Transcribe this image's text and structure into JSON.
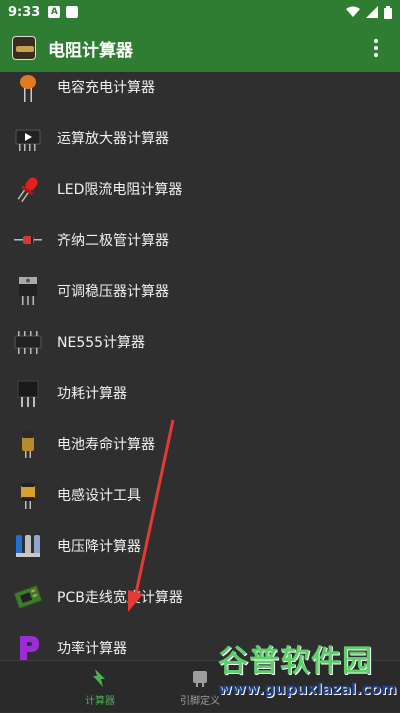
{
  "status_bar": {
    "time": "9:33"
  },
  "app_bar": {
    "title": "电阻计算器"
  },
  "list": {
    "items": [
      {
        "label": "电容充电计算器",
        "icon": "capacitor-icon"
      },
      {
        "label": "运算放大器计算器",
        "icon": "opamp-icon"
      },
      {
        "label": "LED限流电阻计算器",
        "icon": "led-icon"
      },
      {
        "label": "齐纳二极管计算器",
        "icon": "zener-diode-icon"
      },
      {
        "label": "可调稳压器计算器",
        "icon": "voltage-regulator-icon"
      },
      {
        "label": "NE555计算器",
        "icon": "ne555-chip-icon"
      },
      {
        "label": "功耗计算器",
        "icon": "power-transistor-icon"
      },
      {
        "label": "电池寿命计算器",
        "icon": "battery-icon"
      },
      {
        "label": "电感设计工具",
        "icon": "inductor-icon"
      },
      {
        "label": "电压降计算器",
        "icon": "wire-icon"
      },
      {
        "label": "PCB走线宽度计算器",
        "icon": "pcb-icon"
      },
      {
        "label": "功率计算器",
        "icon": "power-p-icon"
      }
    ]
  },
  "bottom_nav": {
    "tabs": [
      {
        "label": "计算器",
        "icon": "calculator-icon",
        "active": true
      },
      {
        "label": "引脚定义",
        "icon": "pinout-icon",
        "active": false
      }
    ]
  },
  "watermark": {
    "line1": "谷普软件园",
    "line2": "www.gupuxlazal.com"
  },
  "colors": {
    "primary": "#2e7d32",
    "background": "#2f2f2f",
    "active_tab": "#4caf50",
    "inactive_tab": "#9e9e9e"
  }
}
